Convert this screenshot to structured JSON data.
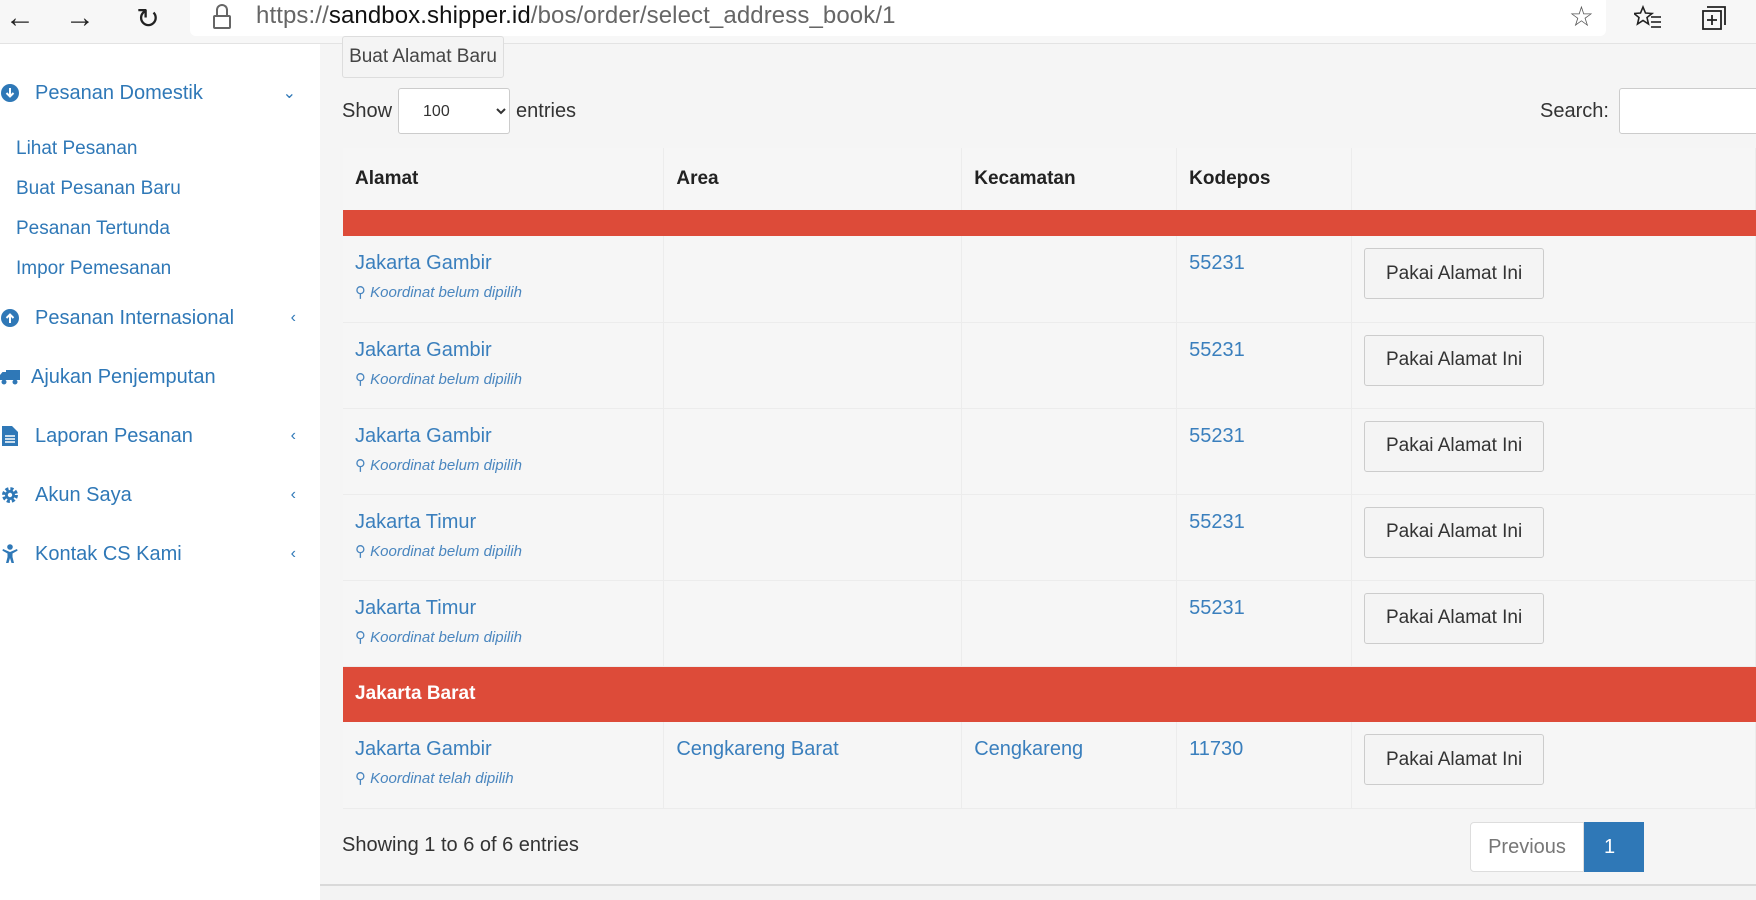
{
  "browser": {
    "url_prefix": "https://",
    "url_host": "sandbox.shipper.id",
    "url_path": "/bos/order/select_address_book/1"
  },
  "sidebar": {
    "domestic": {
      "label": "Pesanan Domestik",
      "icon": "arrow-circle-down-icon"
    },
    "sub_items": [
      "Lihat Pesanan",
      "Buat Pesanan Baru",
      "Pesanan Tertunda",
      "Impor Pemesanan"
    ],
    "international": {
      "label": "Pesanan Internasional",
      "icon": "arrow-circle-up-icon"
    },
    "pickup": {
      "label": "Ajukan Penjemputan",
      "icon": "truck-icon"
    },
    "reports": {
      "label": "Laporan Pesanan",
      "icon": "file-icon"
    },
    "account": {
      "label": "Akun Saya",
      "icon": "gear-icon"
    },
    "contact": {
      "label": "Kontak CS Kami",
      "icon": "child-icon"
    }
  },
  "toolbar": {
    "new_address_label": "Buat Alamat Baru"
  },
  "length": {
    "show_label": "Show",
    "selected": "100",
    "entries_label": "entries"
  },
  "search": {
    "label": "Search:"
  },
  "table": {
    "headers": [
      "Alamat",
      "Area",
      "Kecamatan",
      "Kodepos"
    ],
    "groups": [
      {
        "name": "",
        "rows": [
          {
            "alamat": "Jakarta Gambir",
            "coord": "Koordinat belum dipilih",
            "area": "",
            "kecamatan": "",
            "kodepos": "55231",
            "action": "Pakai Alamat Ini"
          },
          {
            "alamat": "Jakarta Gambir",
            "coord": "Koordinat belum dipilih",
            "area": "",
            "kecamatan": "",
            "kodepos": "55231",
            "action": "Pakai Alamat Ini"
          },
          {
            "alamat": "Jakarta Gambir",
            "coord": "Koordinat belum dipilih",
            "area": "",
            "kecamatan": "",
            "kodepos": "55231",
            "action": "Pakai Alamat Ini"
          },
          {
            "alamat": "Jakarta Timur",
            "coord": "Koordinat belum dipilih",
            "area": "",
            "kecamatan": "",
            "kodepos": "55231",
            "action": "Pakai Alamat Ini"
          },
          {
            "alamat": "Jakarta Timur",
            "coord": "Koordinat belum dipilih",
            "area": "",
            "kecamatan": "",
            "kodepos": "55231",
            "action": "Pakai Alamat Ini"
          }
        ]
      },
      {
        "name": "Jakarta Barat",
        "rows": [
          {
            "alamat": "Jakarta Gambir",
            "coord": "Koordinat telah dipilih",
            "area": "Cengkareng Barat",
            "kecamatan": "Cengkareng",
            "kodepos": "11730",
            "action": "Pakai Alamat Ini"
          }
        ]
      }
    ]
  },
  "footer": {
    "info": "Showing 1 to 6 of 6 entries",
    "previous_label": "Previous",
    "current_page": "1"
  },
  "colors": {
    "accent": "#2f78b7",
    "group_header": "#dd4b39",
    "link": "#3a7fbd"
  }
}
